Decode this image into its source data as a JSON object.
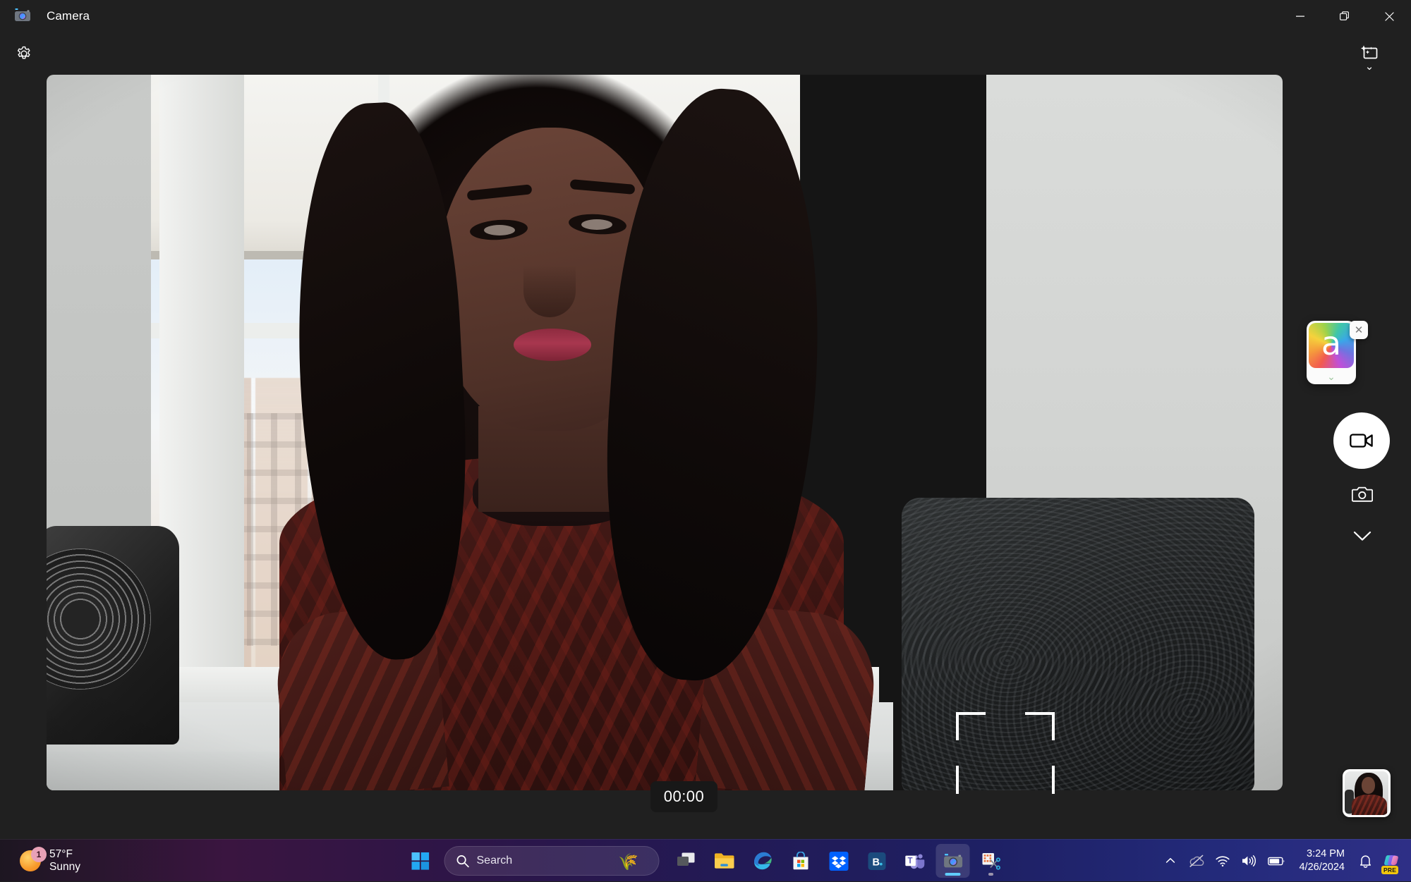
{
  "window": {
    "app_title": "Camera",
    "app_icon": "camera-app-icon",
    "controls": {
      "minimize": "—",
      "maximize": "❐",
      "close": "✕"
    }
  },
  "toolbar": {
    "settings_icon": "gear-icon",
    "effects_icon": "photo-effects-icon",
    "effects_chevron": "⌄"
  },
  "viewfinder": {
    "focus_frame": "focus-tracking-frame",
    "scene_description": "Live camera preview"
  },
  "effects_app": {
    "icon_glyph": "a",
    "icon_name": "rainbow-a-app-icon",
    "chevron": "⌄",
    "close_glyph": "✕"
  },
  "capture_controls": {
    "video_button_icon": "video-camera-icon",
    "photo_button_icon": "photo-camera-icon",
    "more_chevron": "⌄"
  },
  "timer": {
    "value": "00:00"
  },
  "gallery": {
    "thumbnail_name": "last-capture-thumbnail"
  },
  "taskbar": {
    "weather": {
      "temperature": "57°F",
      "condition": "Sunny",
      "badge_count": "1",
      "icon": "sun-icon"
    },
    "start": {
      "icon": "windows-logo-icon",
      "label": "Start"
    },
    "search": {
      "placeholder": "Search",
      "icon": "search-icon",
      "decoration_icon": "forsythia-branch-icon",
      "decoration_glyph": "🌾"
    },
    "pinned": [
      {
        "name": "task-view",
        "label": "Task View",
        "icon": "task-view-icon",
        "active": false
      },
      {
        "name": "file-explorer",
        "label": "File Explorer",
        "icon": "folder-icon",
        "active": false
      },
      {
        "name": "microsoft-edge",
        "label": "Microsoft Edge",
        "icon": "edge-icon",
        "active": false
      },
      {
        "name": "microsoft-store",
        "label": "Microsoft Store",
        "icon": "store-icon",
        "active": false
      },
      {
        "name": "dropbox",
        "label": "Dropbox",
        "icon": "dropbox-icon",
        "active": false
      },
      {
        "name": "backblaze",
        "label": "B.",
        "icon": "backblaze-icon",
        "active": false
      },
      {
        "name": "microsoft-teams",
        "label": "Microsoft Teams",
        "icon": "teams-icon",
        "active": false
      },
      {
        "name": "camera",
        "label": "Camera",
        "icon": "camera-icon",
        "active": true
      },
      {
        "name": "snipping-tool",
        "label": "Snipping Tool",
        "icon": "snipping-tool-icon",
        "active": false
      }
    ],
    "tray": {
      "show_hidden_icons": "chevron-up-icon",
      "onedrive": "onedrive-offline-icon",
      "network": "wifi-icon",
      "volume": "speaker-icon",
      "battery": "battery-icon",
      "time": "3:24 PM",
      "date": "4/26/2024",
      "notifications": "bell-icon",
      "copilot": "copilot-icon",
      "copilot_badge": "PRE"
    }
  },
  "colors": {
    "accent": "#60cdff",
    "window_bg": "#202020",
    "taskbar_start": "#1d1621",
    "taskbar_end": "#2e2f86",
    "badge_pink": "#e8a1b7",
    "copilot_badge": "#f2c60c"
  }
}
